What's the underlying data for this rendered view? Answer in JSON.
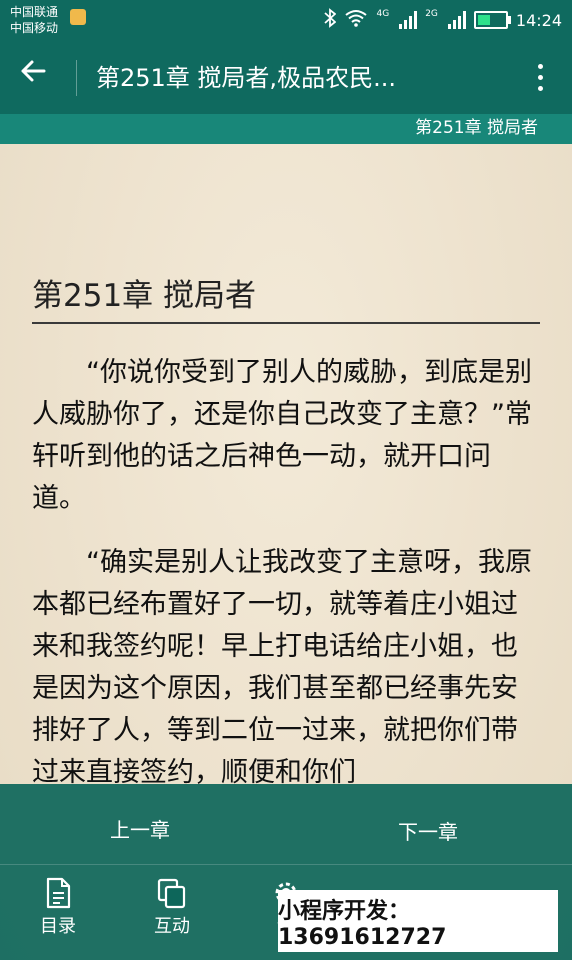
{
  "status": {
    "carrier1": "中国联通",
    "carrier2": "中国移动",
    "net_4g": "4G",
    "net_2g": "2G",
    "time": "14:24",
    "battery_level": 0.45,
    "battery_color": "#2ee08b"
  },
  "appbar": {
    "title": "第251章 搅局者,极品农民...",
    "back_icon": "back-arrow-icon",
    "more_icon": "more-vertical-icon"
  },
  "chapter_bar": {
    "label": "第251章 搅局者"
  },
  "reader": {
    "chapter_title": "第251章 搅局者",
    "paragraphs": [
      "“你说你受到了别人的威胁，到底是别人威胁你了，还是你自己改变了主意？”常轩听到他的话之后神色一动，就开口问道。",
      "“确实是别人让我改变了主意呀，我原本都已经布置好了一切，就等着庄小姐过来和我签约呢！早上打电话给庄小姐，也是因为这个原因，我们甚至都已经事先安排好了人，等到二位一过来，就把你们带过来直接签约，顺便和你们"
    ]
  },
  "bottom": {
    "prev_label": "上一章",
    "next_label": "下一章",
    "nav": [
      {
        "label": "目录",
        "icon": "document-icon"
      },
      {
        "label": "互动",
        "icon": "copy-icon"
      },
      {
        "label": "设",
        "icon": "settings-icon"
      }
    ]
  },
  "watermark": "小程序开发：13691612727",
  "colors": {
    "primary": "#0f6a5f",
    "chapter_bar": "#188779",
    "paper": "#efe5d2"
  }
}
